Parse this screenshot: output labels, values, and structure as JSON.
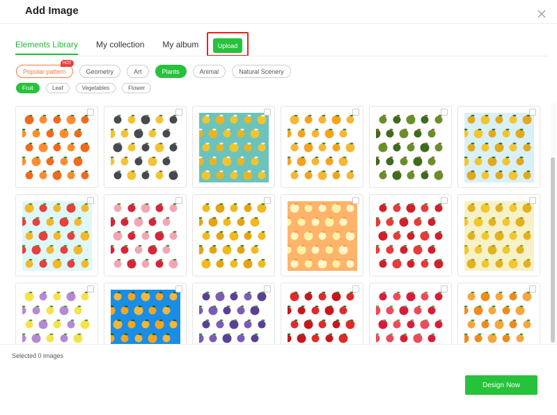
{
  "dialog": {
    "title": "Add Image"
  },
  "tabs": [
    {
      "label": "Elements Library",
      "active": true
    },
    {
      "label": "My collection",
      "active": false
    },
    {
      "label": "My album",
      "active": false
    }
  ],
  "upload_label": "Upload",
  "categories": [
    {
      "label": "Popular pattern",
      "badge": "HOT"
    },
    {
      "label": "Geometry"
    },
    {
      "label": "Art"
    },
    {
      "label": "Plants",
      "active": true
    },
    {
      "label": "Animal"
    },
    {
      "label": "Natural Scenery"
    }
  ],
  "subcategories": [
    {
      "label": "Fruit",
      "active": true
    },
    {
      "label": "Leaf"
    },
    {
      "label": "Vegetables"
    },
    {
      "label": "Flower"
    }
  ],
  "patterns": [
    {
      "name": "orange",
      "bg": "#ffffff",
      "colors": [
        "#f26a1b",
        "#ff8c2e"
      ],
      "leaf": "#2f8a3a"
    },
    {
      "name": "lemon-slice",
      "bg": "#ffffff",
      "colors": [
        "#f4c430",
        "#444a4f"
      ],
      "leaf": "#6d7a5a"
    },
    {
      "name": "banana",
      "bg": "#6cc3bc",
      "colors": [
        "#f0c52d",
        "#e8b421"
      ],
      "leaf": "#ffffff"
    },
    {
      "name": "orange-fruit",
      "bg": "#ffffff",
      "colors": [
        "#f7a21b",
        "#f6b733"
      ],
      "leaf": "#3d8a3d"
    },
    {
      "name": "green-apple",
      "bg": "#ffffff",
      "colors": [
        "#6a8f2a",
        "#3f6b1f"
      ],
      "leaf": "#8b6b3a"
    },
    {
      "name": "pineapple-blue",
      "bg": "#d9f0f6",
      "colors": [
        "#f4c430",
        "#e3a91e"
      ],
      "leaf": "#2d7a3b"
    },
    {
      "name": "pineapple-cherry",
      "bg": "#dff7f7",
      "colors": [
        "#f4b72a",
        "#e83f3f"
      ],
      "leaf": "#3e9a3e"
    },
    {
      "name": "cherry-flower",
      "bg": "#ffffff",
      "colors": [
        "#d8243a",
        "#f2a6b5"
      ],
      "leaf": "#4f8a3c"
    },
    {
      "name": "pineapple",
      "bg": "#ffffff",
      "colors": [
        "#f2b81c",
        "#e6a313"
      ],
      "leaf": "#3a8a2e"
    },
    {
      "name": "orange-dots",
      "bg": "#ffb36b",
      "colors": [
        "#fbf3a8",
        "#fff6c4"
      ],
      "leaf": "#f59b4c"
    },
    {
      "name": "cherry-red",
      "bg": "#ffffff",
      "colors": [
        "#d11f2b",
        "#e83a3a"
      ],
      "leaf": "#4d8b3b"
    },
    {
      "name": "pineapple-yellow",
      "bg": "#f7f1c7",
      "colors": [
        "#f2c72a",
        "#e2b21e"
      ],
      "leaf": "#8aa23e"
    },
    {
      "name": "lemon-purple",
      "bg": "#ffffff",
      "colors": [
        "#f5e34a",
        "#b48ad6"
      ],
      "leaf": "#5b9a3f"
    },
    {
      "name": "orange-blue",
      "bg": "#1a8ee6",
      "colors": [
        "#f7a520",
        "#f4b63b"
      ],
      "leaf": "#1e5f2a"
    },
    {
      "name": "grape",
      "bg": "#ffffff",
      "colors": [
        "#5a3f96",
        "#7c5ab8"
      ],
      "leaf": "#3e8f3e"
    },
    {
      "name": "pepper",
      "bg": "#ffffff",
      "colors": [
        "#c8161d",
        "#e02a2a"
      ],
      "leaf": "#2f7a2a"
    },
    {
      "name": "cherry-leaf",
      "bg": "#ffffff",
      "colors": [
        "#d81c3c",
        "#ee4a5a"
      ],
      "leaf": "#6b9a54"
    },
    {
      "name": "orange-leaf",
      "bg": "#ffffff",
      "colors": [
        "#f28a1a",
        "#f6a63a"
      ],
      "leaf": "#3a9a4a"
    }
  ],
  "status": {
    "selected_text": "Selected 0 images"
  },
  "footer": {
    "design_label": "Design Now"
  }
}
